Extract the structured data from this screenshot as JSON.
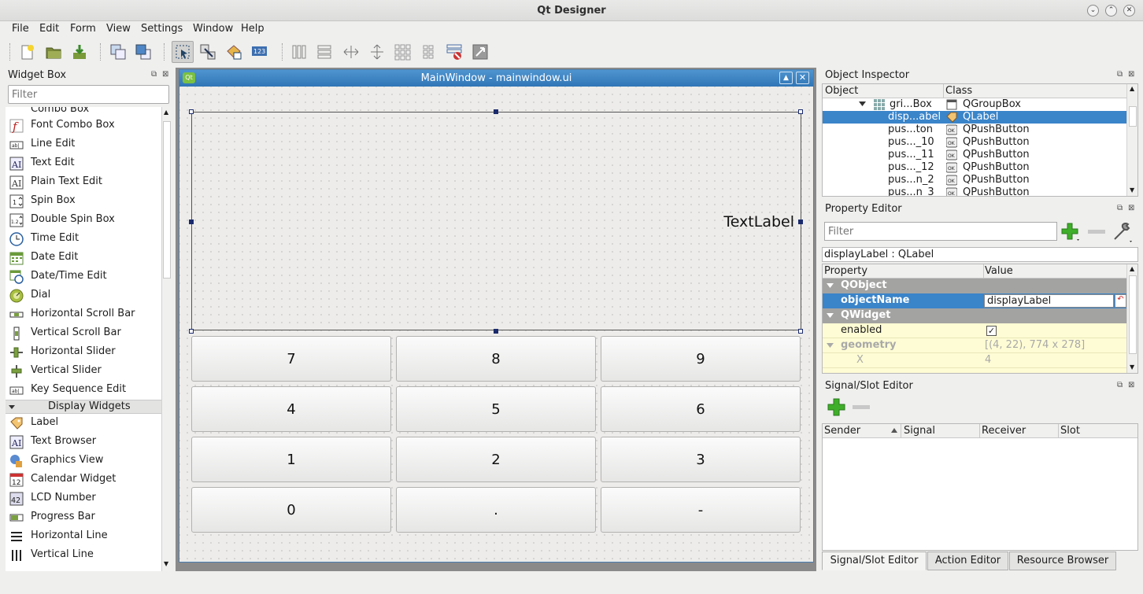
{
  "window": {
    "title": "Qt Designer"
  },
  "menubar": [
    "File",
    "Edit",
    "Form",
    "View",
    "Settings",
    "Window",
    "Help"
  ],
  "widget_box": {
    "title": "Widget Box",
    "filter_placeholder": "Filter",
    "partial_top_item": "Combo Box",
    "items_top": [
      "Font Combo Box",
      "Line Edit",
      "Text Edit",
      "Plain Text Edit",
      "Spin Box",
      "Double Spin Box",
      "Time Edit",
      "Date Edit",
      "Date/Time Edit",
      "Dial",
      "Horizontal Scroll Bar",
      "Vertical Scroll Bar",
      "Horizontal Slider",
      "Vertical Slider",
      "Key Sequence Edit"
    ],
    "category": "Display Widgets",
    "items_bottom": [
      "Label",
      "Text Browser",
      "Graphics View",
      "Calendar Widget",
      "LCD Number",
      "Progress Bar",
      "Horizontal Line",
      "Vertical Line"
    ]
  },
  "form": {
    "title": "MainWindow - mainwindow.ui",
    "label_text": "TextLabel",
    "keys": [
      "7",
      "8",
      "9",
      "4",
      "5",
      "6",
      "1",
      "2",
      "3",
      "0",
      ".",
      "-"
    ]
  },
  "object_inspector": {
    "title": "Object Inspector",
    "col_object": "Object",
    "col_class": "Class",
    "rows": [
      {
        "object": "gri...Box",
        "class": "QGroupBox"
      },
      {
        "object": "disp...abel",
        "class": "QLabel"
      },
      {
        "object": "pus...ton",
        "class": "QPushButton"
      },
      {
        "object": "pus..._10",
        "class": "QPushButton"
      },
      {
        "object": "pus..._11",
        "class": "QPushButton"
      },
      {
        "object": "pus..._12",
        "class": "QPushButton"
      },
      {
        "object": "pus...n_2",
        "class": "QPushButton"
      },
      {
        "object": "pus...n_3",
        "class": "QPushButton"
      }
    ]
  },
  "property_editor": {
    "title": "Property Editor",
    "filter_placeholder": "Filter",
    "object_caption": "displayLabel : QLabel",
    "col_property": "Property",
    "col_value": "Value",
    "cat_qobject": "QObject",
    "objectName_label": "objectName",
    "objectName_value": "displayLabel",
    "cat_qwidget": "QWidget",
    "enabled_label": "enabled",
    "enabled_value": "✓",
    "geometry_label": "geometry",
    "geometry_value": "[(4, 22), 774 x 278]",
    "x_label": "X",
    "x_value": "4"
  },
  "signal_slot": {
    "title": "Signal/Slot Editor",
    "columns": [
      "Sender",
      "Signal",
      "Receiver",
      "Slot"
    ]
  },
  "bottom_tabs": [
    "Signal/Slot Editor",
    "Action Editor",
    "Resource Browser"
  ]
}
